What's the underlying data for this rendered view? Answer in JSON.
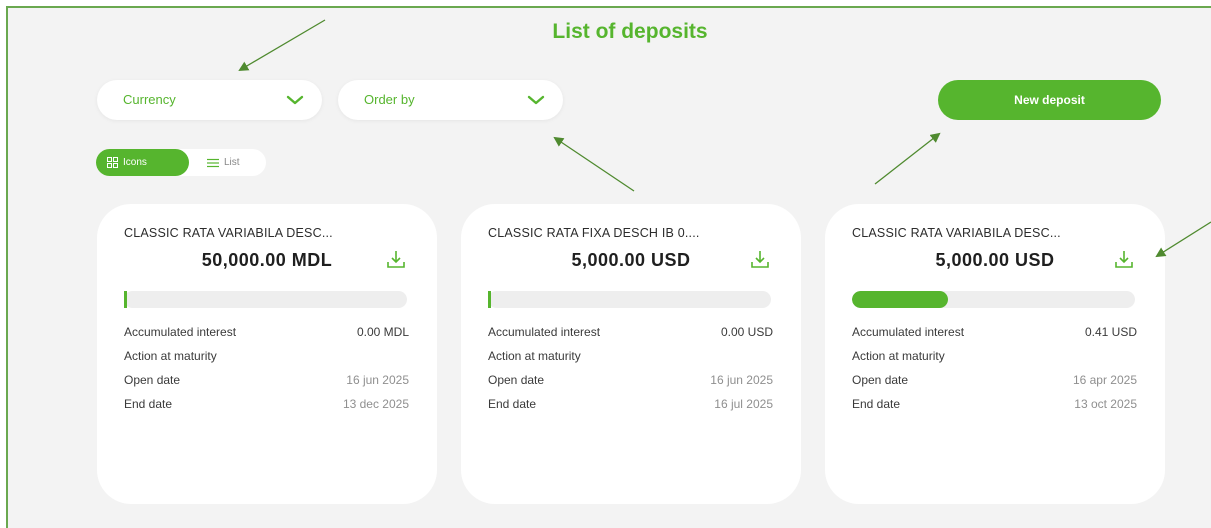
{
  "page": {
    "title": "List of deposits"
  },
  "filters": {
    "currency_label": "Currency",
    "order_by_label": "Order by"
  },
  "actions": {
    "new_deposit_label": "New deposit"
  },
  "view_toggle": {
    "icons_label": "Icons",
    "list_label": "List",
    "selected": "Icons"
  },
  "labels": {
    "accumulated_interest": "Accumulated interest",
    "action_at_maturity": "Action at maturity",
    "open_date": "Open date",
    "end_date": "End date"
  },
  "deposits": [
    {
      "name": "CLASSIC RATA VARIABILA DESC...",
      "amount": "50,000.00 MDL",
      "progress": 0.0,
      "accumulated_interest": "0.00 MDL",
      "action_at_maturity": "",
      "open_date": "16 jun 2025",
      "end_date": "13 dec 2025"
    },
    {
      "name": "CLASSIC RATA FIXA DESCH IB 0....",
      "amount": "5,000.00 USD",
      "progress": 0.0,
      "accumulated_interest": "0.00 USD",
      "action_at_maturity": "",
      "open_date": "16 jun 2025",
      "end_date": "16 jul 2025"
    },
    {
      "name": "CLASSIC RATA VARIABILA DESC...",
      "amount": "5,000.00 USD",
      "progress": 0.34,
      "accumulated_interest": "0.41 USD",
      "action_at_maturity": "",
      "open_date": "16 apr 2025",
      "end_date": "13 oct 2025"
    }
  ],
  "colors": {
    "accent": "#56b52e",
    "annotation_arrow": "#4f8a2f",
    "background": "#f3f3f3"
  },
  "icons": {
    "dropdown": "chevron-down-icon",
    "download": "download-icon",
    "grid_view": "grid-icon",
    "list_view": "list-icon"
  }
}
